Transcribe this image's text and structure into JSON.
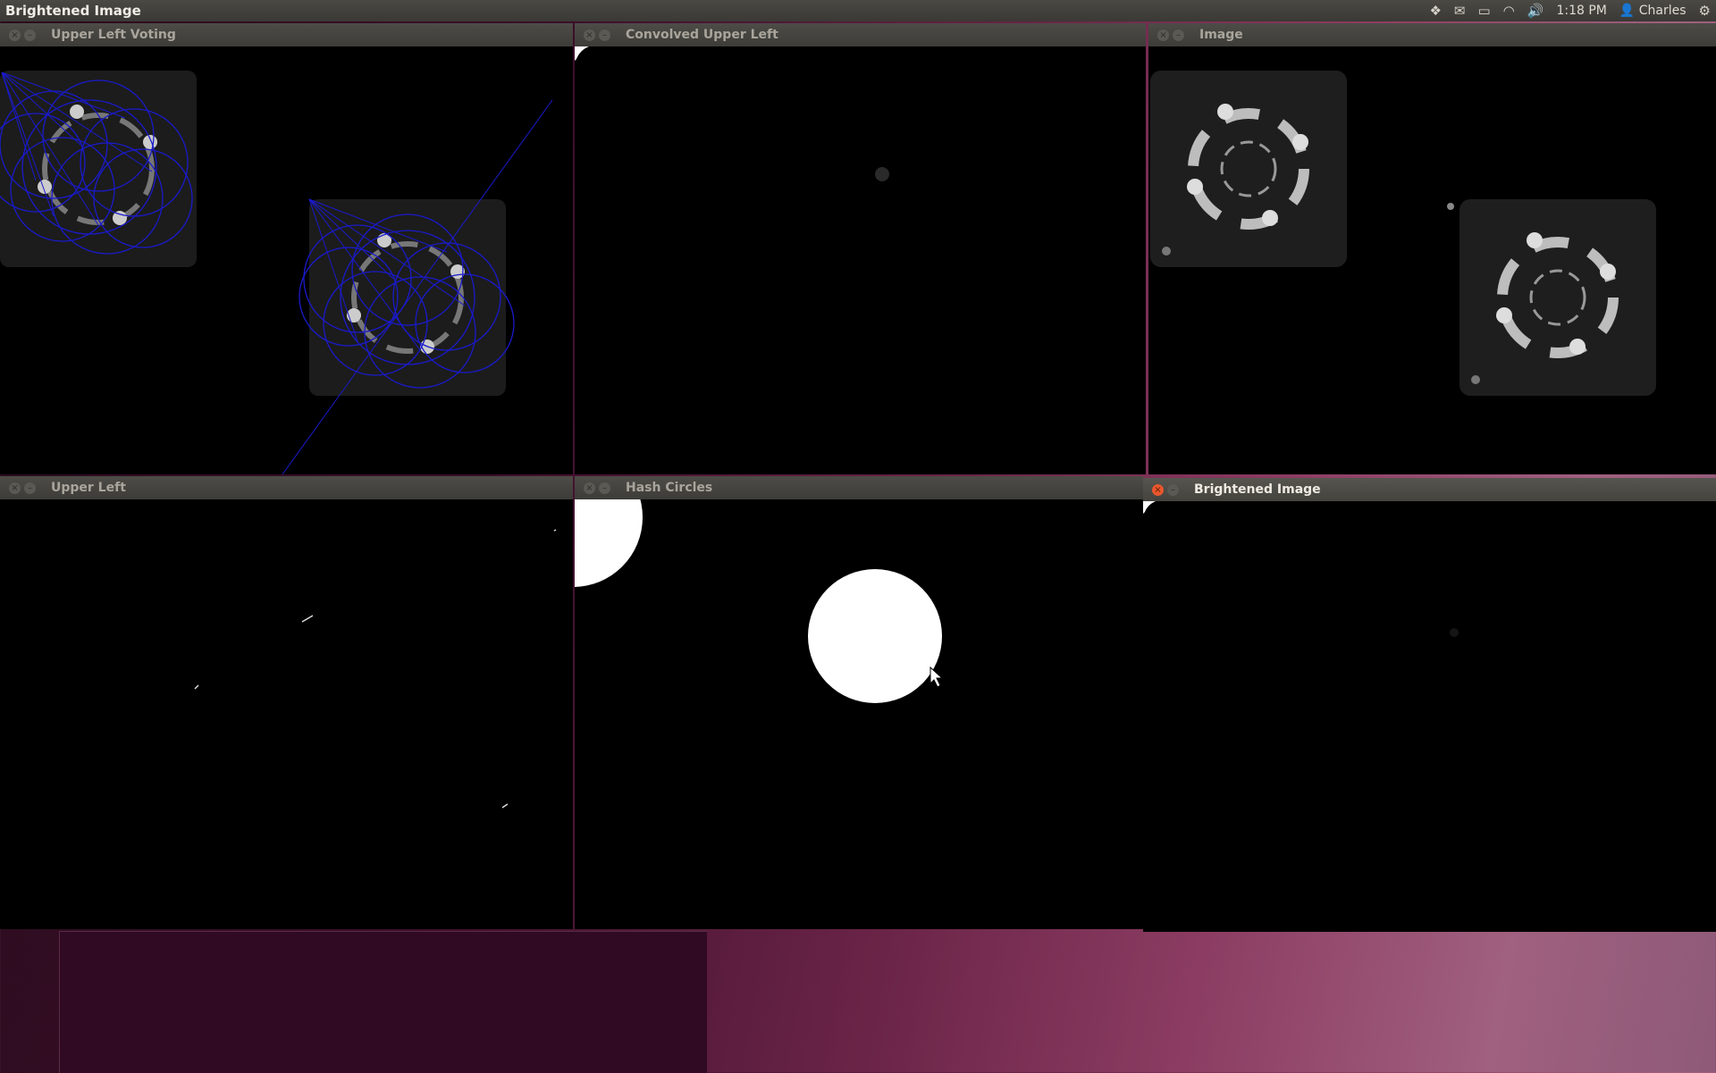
{
  "topbar": {
    "app_title": "Brightened Image",
    "icons": [
      "dropbox-icon",
      "mail-icon",
      "battery-icon",
      "wifi-icon",
      "volume-icon"
    ],
    "time": "1:18 PM",
    "user": "Charles",
    "gear_icon": "gear-icon"
  },
  "windows": {
    "voting": {
      "title": "Upper Left Voting"
    },
    "convolved": {
      "title": "Convolved Upper Left"
    },
    "image": {
      "title": "Image"
    },
    "upper_left": {
      "title": "Upper Left"
    },
    "hash": {
      "title": "Hash Circles"
    },
    "brightened": {
      "title": "Brightened Image"
    }
  },
  "colors": {
    "accent_close": "#e8572c",
    "vote_lines": "#1a1acc",
    "desktop": "#6a2447"
  }
}
